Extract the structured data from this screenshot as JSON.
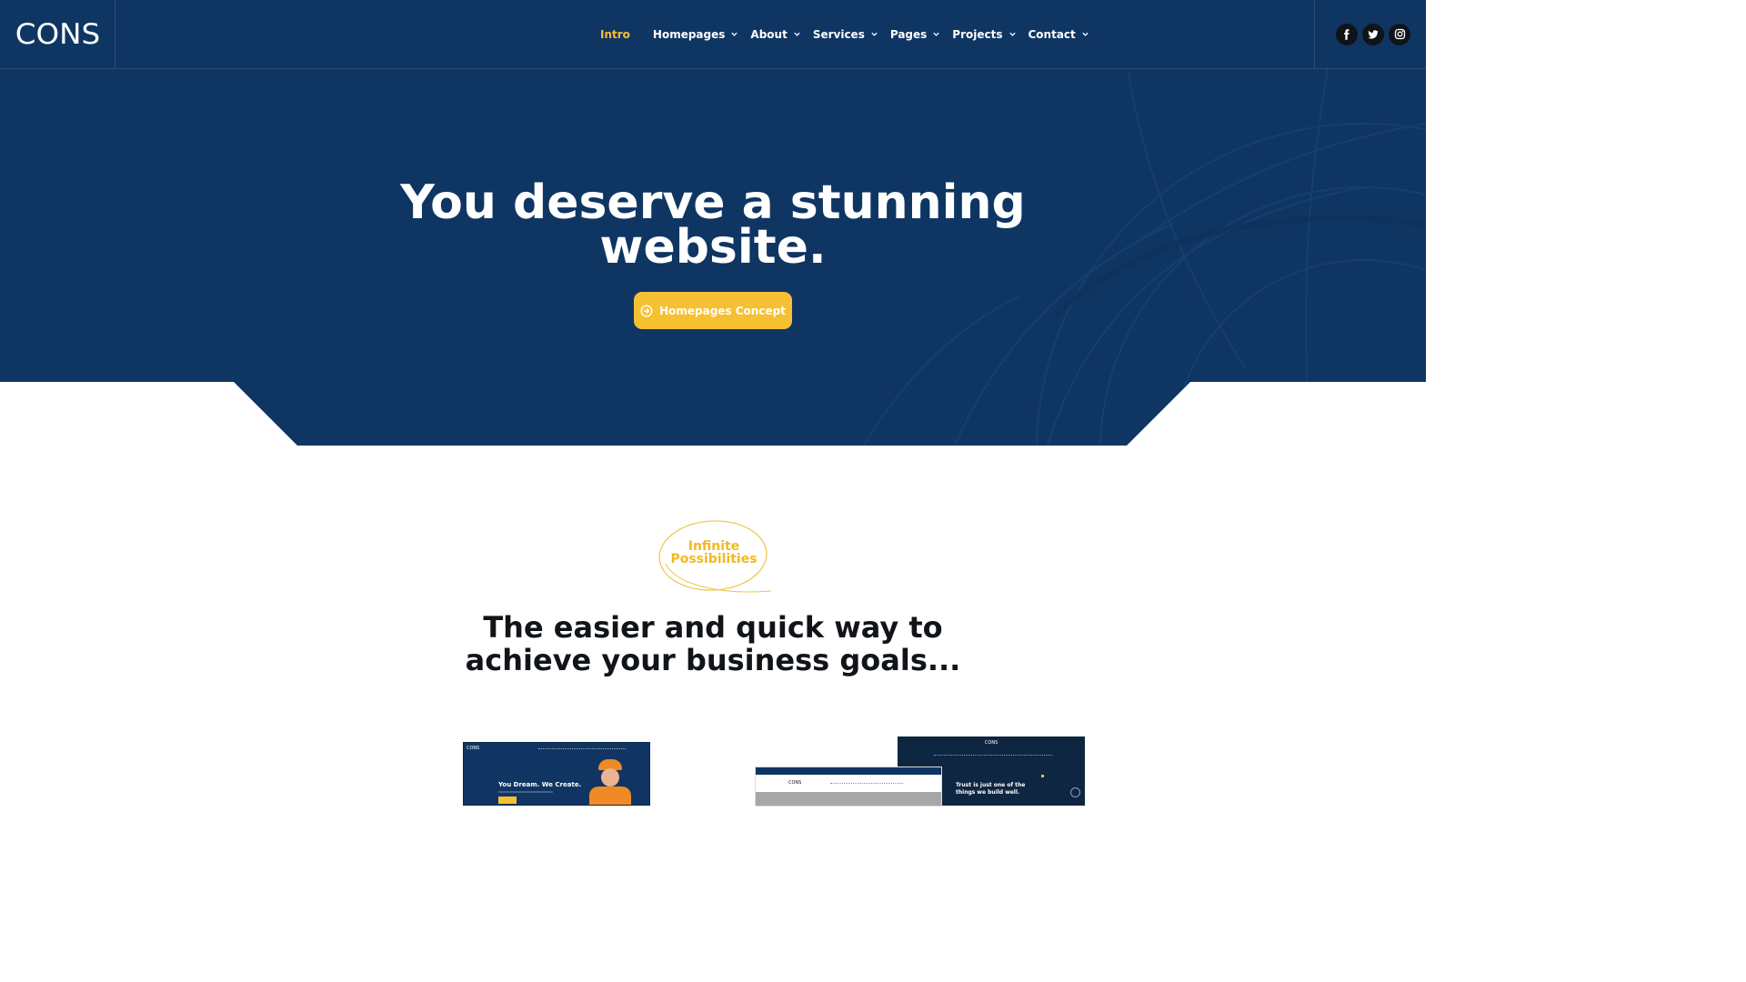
{
  "header": {
    "logo": "CONS",
    "nav": [
      {
        "label": "Intro",
        "active": true,
        "dropdown": false
      },
      {
        "label": "Homepages",
        "active": false,
        "dropdown": true
      },
      {
        "label": "About",
        "active": false,
        "dropdown": true
      },
      {
        "label": "Services",
        "active": false,
        "dropdown": true
      },
      {
        "label": "Pages",
        "active": false,
        "dropdown": true
      },
      {
        "label": "Projects",
        "active": false,
        "dropdown": true
      },
      {
        "label": "Contact",
        "active": false,
        "dropdown": true
      }
    ],
    "social": [
      "facebook-icon",
      "twitter-icon",
      "instagram-icon"
    ]
  },
  "hero": {
    "title_line1": "You deserve a stunning",
    "title_line2": "website.",
    "cta_label": "Homepages Concept"
  },
  "section": {
    "badge_line1": "Infinite",
    "badge_line2": "Possibilities",
    "title_line1": "The easier and quick way to",
    "title_line2": "achieve your business goals..."
  },
  "thumbnails": {
    "one": {
      "logo": "CONS",
      "headline": "You Dream. We Create."
    },
    "two_back": {
      "logo": "CONS",
      "headline_line1": "Trust is just one of the",
      "headline_line2": "things we build well."
    },
    "two_front": {
      "logo": "CONS"
    }
  },
  "colors": {
    "navy": "#0f3563",
    "accent": "#f6c033",
    "text_dark": "#111418"
  }
}
